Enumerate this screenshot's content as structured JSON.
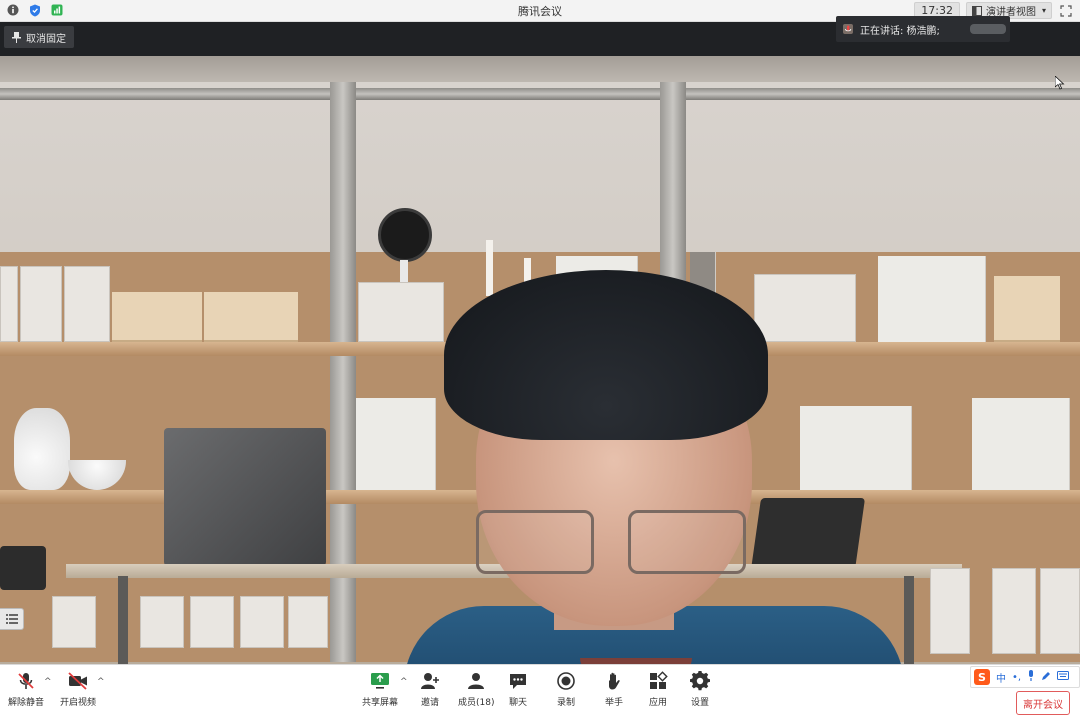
{
  "window": {
    "title": "腾讯会议",
    "time": "17:32",
    "view_mode": "演讲者视图"
  },
  "top_bar": {
    "unpin_label": "取消固定",
    "speaking_label": "正在讲话: 杨浩鹏;"
  },
  "toolbar": {
    "left": [
      {
        "name": "unmute",
        "label": "解除静音"
      },
      {
        "name": "start-video",
        "label": "开启视频"
      }
    ],
    "center": [
      {
        "name": "share-screen",
        "label": "共享屏幕"
      },
      {
        "name": "invite",
        "label": "邀请"
      },
      {
        "name": "members",
        "label": "成员(18)"
      },
      {
        "name": "chat",
        "label": "聊天"
      },
      {
        "name": "record",
        "label": "录制"
      },
      {
        "name": "raise-hand",
        "label": "举手"
      },
      {
        "name": "apps",
        "label": "应用"
      },
      {
        "name": "settings",
        "label": "设置"
      }
    ],
    "leave_label": "离开会议"
  },
  "ime": {
    "lang": "中"
  },
  "colors": {
    "accent_red": "#d93838",
    "toolbar_bg": "#ffffff",
    "dark_bg": "#1f2124"
  }
}
